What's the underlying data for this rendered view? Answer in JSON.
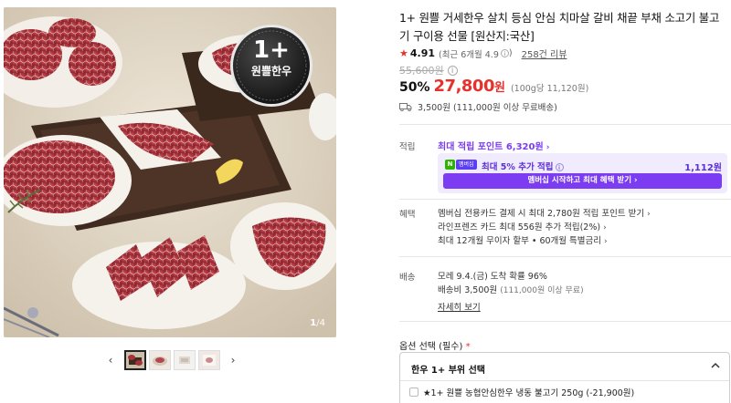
{
  "gallery": {
    "badge_top": "1+",
    "badge_bottom": "원쁠한우",
    "counter_current": "1",
    "counter_sep": "/",
    "counter_total": "4",
    "prev_icon": "‹",
    "next_icon": "›"
  },
  "product": {
    "title": "1+ 원쁠 거세한우 살치 등심 안심 치마살 갈비 채끝 부채 소고기 불고기 구이용 선물 [원산지:국산]",
    "star": "★",
    "rating": "4.91",
    "rating_recent": "(최근 6개월 4.9",
    "rating_recent_close": ")",
    "info_mark": "i",
    "review_link": "258건 리뷰",
    "original_price": "55,600원",
    "discount": "50%",
    "sale_price": "27,800",
    "sale_won": "원",
    "unit_price": "(100g당 11,120원)",
    "shipping": "3,500원 (111,000원 이상 무료배송)"
  },
  "points": {
    "label": "적립",
    "max_points": "최대 적립 포인트 6,320원",
    "chevron": "›",
    "member_n": "N",
    "member_plus": "멤버십",
    "member_text": "최대 5% 추가 적립",
    "member_value": "1,112원",
    "member_button": "멤버십 시작하고 최대 혜택 받기 ›"
  },
  "benefits": {
    "label": "혜택",
    "items": [
      "멤버십 전용카드 결제 시 최대 2,780원 적립 포인트 받기",
      "라인프렌즈 카드 최대 556원 추가 적립(2%)",
      "최대 12개월 무이자 할부 • 60개월 특별금리"
    ]
  },
  "delivery": {
    "label": "배송",
    "arrival": "모레 9.4.(금) 도착 확률 96%",
    "fee": "배송비 3,500원",
    "fee_note": "(111,000원 이상 무료)",
    "more_link": "자세히 보기"
  },
  "options": {
    "label": "옵션 선택 (필수)",
    "required_mark": "*",
    "head": "한우 1+ 부위 선택",
    "first_item": "★1+ 원쁠 농협안심한우 냉동 불고기 250g (-21,900원)"
  },
  "colors": {
    "accent_red": "#e5322d",
    "point_purple": "#7a3df0",
    "member_bg": "#f1ecfd",
    "naver_green": "#2db400"
  }
}
